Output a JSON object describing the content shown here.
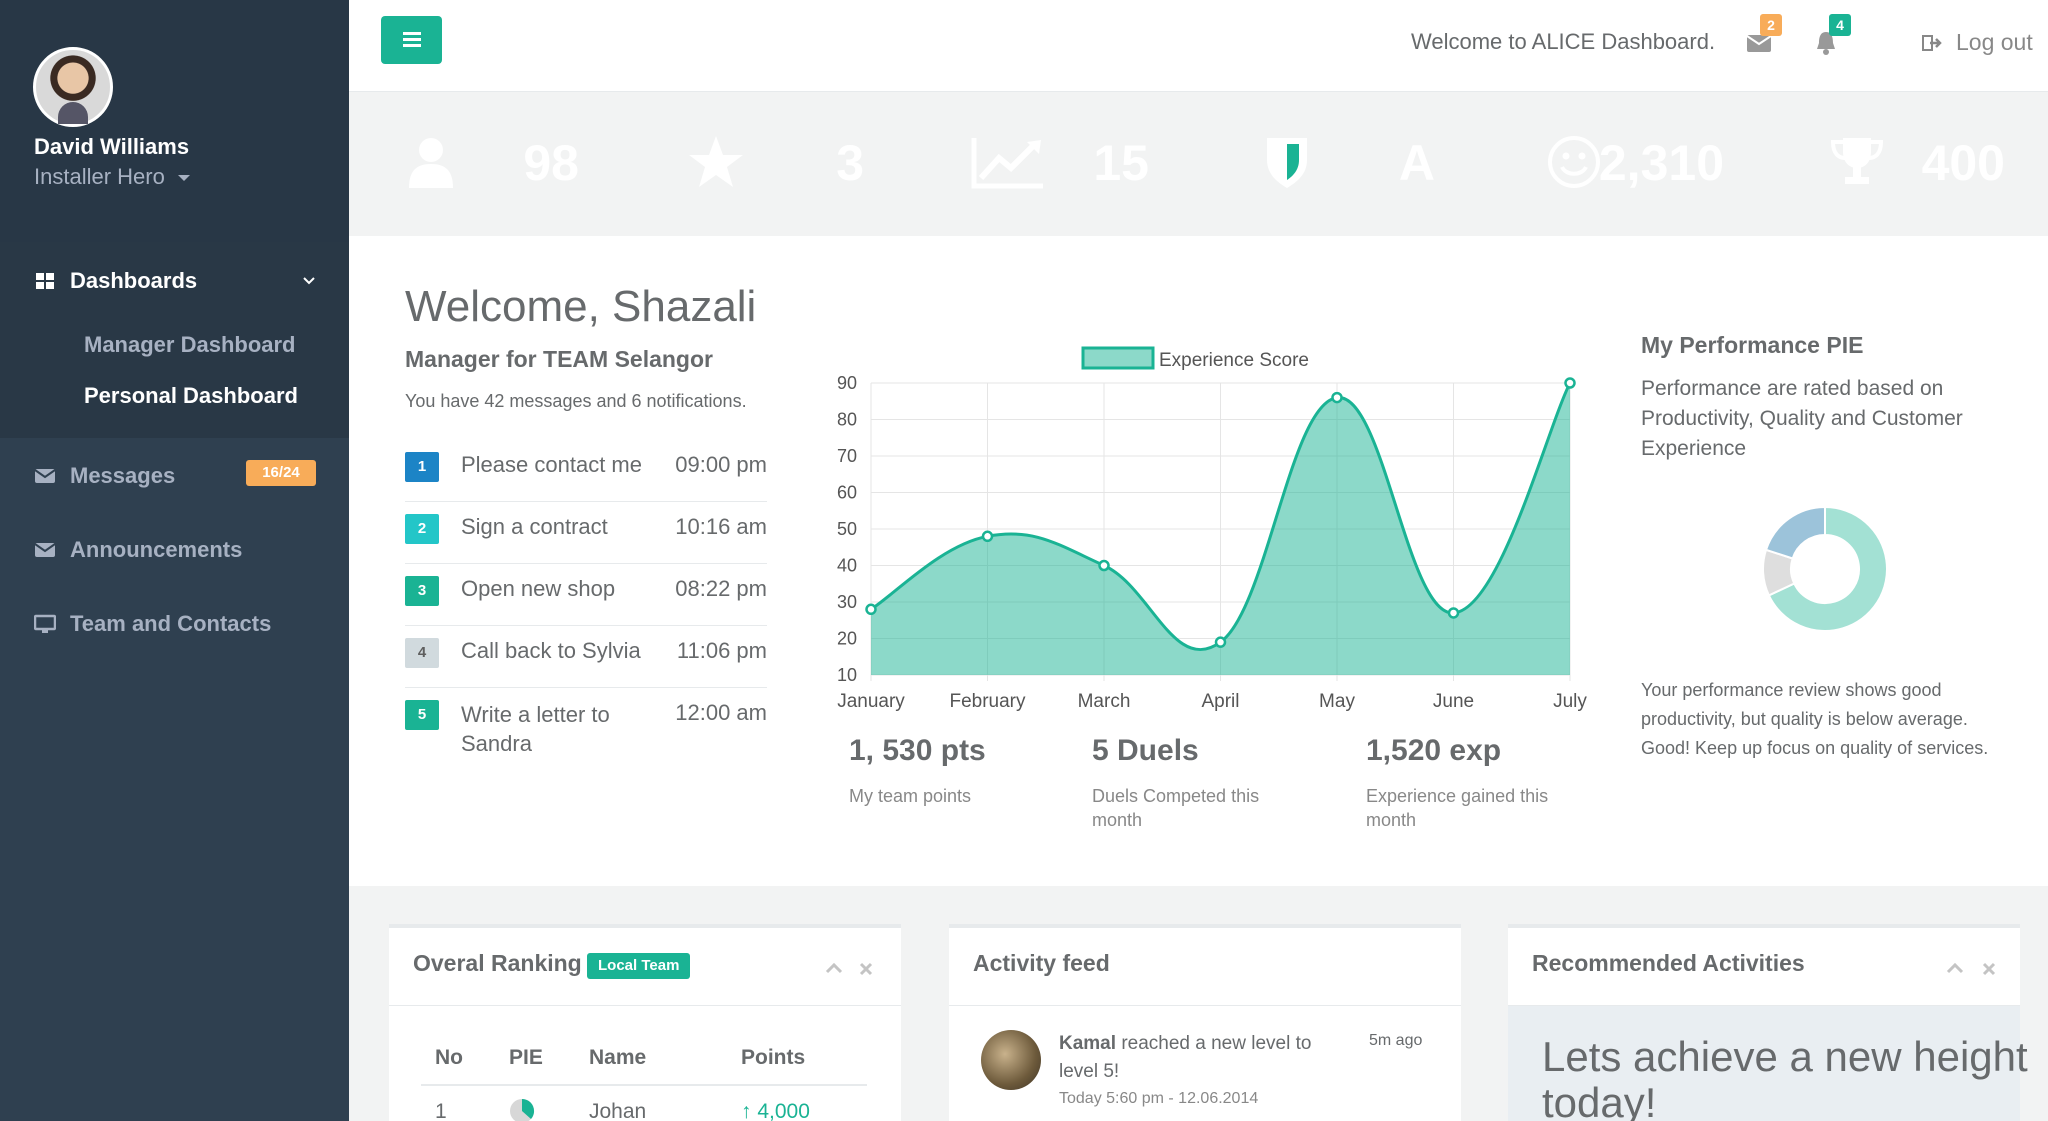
{
  "profile": {
    "name": "David Williams",
    "role": "Installer Hero"
  },
  "nav": {
    "dashboards": "Dashboards",
    "sub": [
      "Manager Dashboard",
      "Personal Dashboard"
    ],
    "messages": "Messages",
    "messages_badge": "16/24",
    "announcements": "Announcements",
    "team": "Team and Contacts"
  },
  "topbar": {
    "welcome": "Welcome to ALICE Dashboard.",
    "mail_count": "2",
    "bell_count": "4",
    "logout": "Log out"
  },
  "stats": [
    {
      "value": "98",
      "icon": "user-icon",
      "color": "#1ab394"
    },
    {
      "value": "3",
      "icon": "star-icon",
      "color": "#f8ac59"
    },
    {
      "value": "15",
      "icon": "line-chart-icon",
      "color": "#1ab394"
    },
    {
      "value": "A",
      "icon": "shield-icon",
      "color": "#1ab394"
    },
    {
      "value": "2,310",
      "icon": "smile-icon",
      "color": "#23c6c8"
    },
    {
      "value": "400",
      "icon": "trophy-icon",
      "color": "#23c6c8"
    }
  ],
  "welcome": {
    "greeting": "Welcome, Shazali",
    "team": "Manager for TEAM Selangor",
    "summary": "You have 42 messages and 6 notifications."
  },
  "todos": [
    {
      "num": "1",
      "text": "Please contact me",
      "time": "09:00 pm",
      "color": "#1c84c6"
    },
    {
      "num": "2",
      "text": "Sign a contract",
      "time": "10:16 am",
      "color": "#23c6c8"
    },
    {
      "num": "3",
      "text": "Open new shop",
      "time": "08:22 pm",
      "color": "#1ab394"
    },
    {
      "num": "4",
      "text": "Call back to Sylvia",
      "time": "11:06 pm",
      "color": "#d1dade"
    },
    {
      "num": "5",
      "text": "Write a letter to Sandra",
      "time": "12:00 am",
      "color": "#1ab394"
    }
  ],
  "chart_data": {
    "type": "area",
    "categories": [
      "January",
      "February",
      "March",
      "April",
      "May",
      "June",
      "July"
    ],
    "series": [
      {
        "name": "Experience Score",
        "values": [
          28,
          48,
          40,
          19,
          86,
          27,
          90
        ]
      }
    ],
    "ylim": [
      10,
      90
    ],
    "yticks": [
      10,
      20,
      30,
      40,
      50,
      60,
      70,
      80,
      90
    ],
    "grid": true,
    "legend": "top",
    "color": "#1ab394"
  },
  "kpis": [
    {
      "value": "1, 530 pts",
      "label": "My team points"
    },
    {
      "value": "5 Duels",
      "label": "Duels Competed this month"
    },
    {
      "value": "1,520 exp",
      "label": "Experience gained this month"
    }
  ],
  "performance": {
    "title": "My Performance PIE",
    "description": "Performance are rated based on Productivity, Quality and Customer Experience",
    "review": "Your performance review shows good productivity, but quality is below average. Good! Keep up focus on quality of services.",
    "pie": [
      {
        "value": 68,
        "color": "#a3e1d4"
      },
      {
        "value": 12,
        "color": "#dedede"
      },
      {
        "value": 20,
        "color": "#9cc3da"
      }
    ]
  },
  "ranking": {
    "title": "Overal Ranking",
    "label": "Local Team",
    "headers": [
      "No",
      "PIE",
      "Name",
      "Points"
    ],
    "rows": [
      {
        "no": "1",
        "name": "Johan",
        "points": "4,000"
      }
    ]
  },
  "feed": {
    "title": "Activity feed",
    "user": "Kamal",
    "text": "reached a new level to level 5!",
    "time": "5m ago",
    "date": "Today 5:60 pm - 12.06.2014"
  },
  "recommended": {
    "title": "Recommended Activities",
    "text": "Lets achieve a new height today!"
  }
}
